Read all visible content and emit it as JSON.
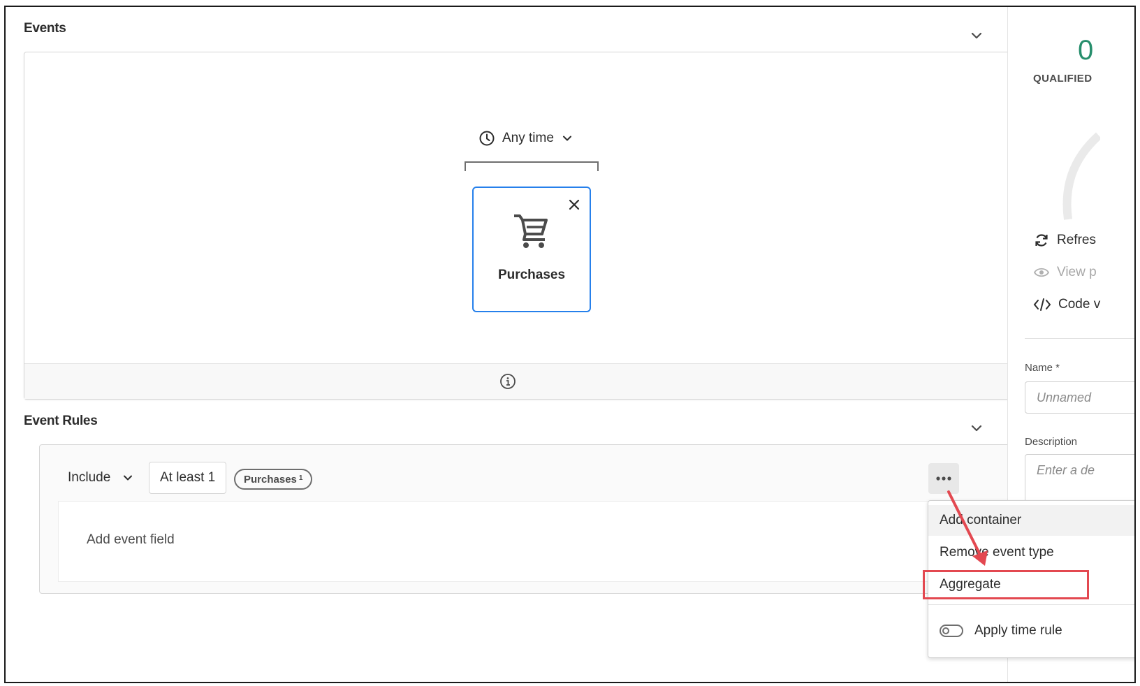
{
  "events": {
    "title": "Events",
    "time_picker": {
      "label": "Any time"
    },
    "event_card": {
      "label": "Purchases"
    }
  },
  "event_rules": {
    "title": "Event Rules",
    "include_label": "Include",
    "count_label": "At least 1",
    "chip_label": "Purchases",
    "chip_count": "1",
    "add_field_label": "Add event field"
  },
  "context_menu": {
    "items": [
      "Add container",
      "Remove event type",
      "Aggregate"
    ],
    "toggle_label": "Apply time rule",
    "highlighted_item": "Aggregate"
  },
  "right_panel": {
    "count_partial": "0",
    "qualified_label": "QUALIFIED",
    "actions": [
      "Refres",
      "View p",
      "Code v"
    ],
    "name_label": "Name *",
    "name_placeholder": "Unnamed",
    "description_label": "Description",
    "description_placeholder": "Enter a de"
  },
  "colors": {
    "accent_blue": "#2680eb",
    "highlight_red": "#e34850",
    "success_green": "#268e6c"
  }
}
